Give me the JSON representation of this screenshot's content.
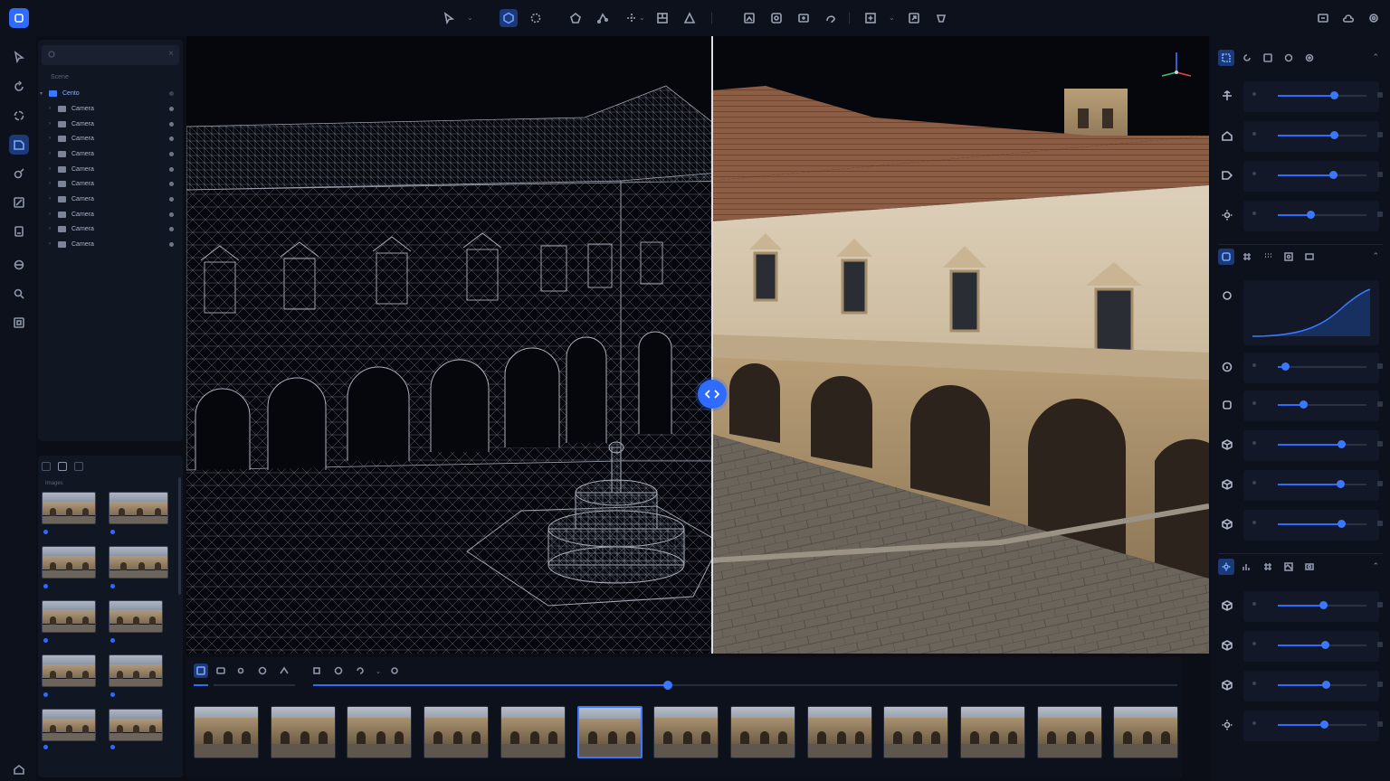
{
  "scene": {
    "header": "Scene",
    "root_label": "Cento",
    "items": [
      "Camera",
      "Camera",
      "Camera",
      "Camera",
      "Camera",
      "Camera",
      "Camera",
      "Camera",
      "Camera",
      "Camera"
    ]
  },
  "media": {
    "label": "Images"
  },
  "timeline": {
    "progress": 0.41,
    "frame_count": 13,
    "selected_frame": 5
  },
  "properties": {
    "transform_sliders": [
      0.63,
      0.63,
      0.62,
      0.37
    ],
    "curve_icon": "curve-icon",
    "material_sliders": [
      0.08,
      0.29,
      0.71,
      0.7,
      0.71
    ],
    "light_sliders": [
      0.51,
      0.53,
      0.54,
      0.52
    ]
  },
  "colors": {
    "accent": "#2f6bff",
    "panel": "#111623",
    "bg": "#0b0e16"
  }
}
